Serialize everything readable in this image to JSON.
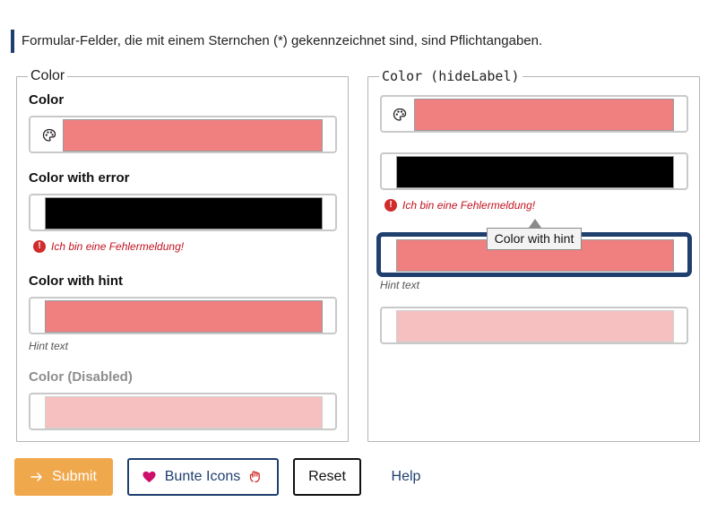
{
  "notice": "Formular-Felder, die mit einem Sternchen (*) gekennzeichnet sind, sind Pflichtangaben.",
  "left": {
    "legend": "Color",
    "color_label": "Color",
    "color_error_label": "Color with error",
    "error_text": "Ich bin eine Fehlermeldung!",
    "color_hint_label": "Color with hint",
    "hint_text": "Hint text",
    "disabled_label": "Color (Disabled)"
  },
  "right": {
    "legend": "Color (hideLabel)",
    "error_text": "Ich bin eine Fehlermeldung!",
    "tooltip": "Color with hint",
    "hint_text": "Hint text"
  },
  "colors": {
    "value": "#f08080",
    "error_value": "#000000",
    "disabled_value": "#f7c0c0",
    "brand": "#1f3f6e",
    "submit_bg": "#f0a84c",
    "error": "#d12b2b"
  },
  "buttons": {
    "submit": "Submit",
    "icons": "Bunte Icons",
    "reset": "Reset",
    "help": "Help"
  },
  "icons": {
    "palette": "palette-icon",
    "error": "exclamation-circle-icon",
    "submit": "arrow-right-icon",
    "heart": "heart-icon",
    "hand": "hand-icon"
  }
}
